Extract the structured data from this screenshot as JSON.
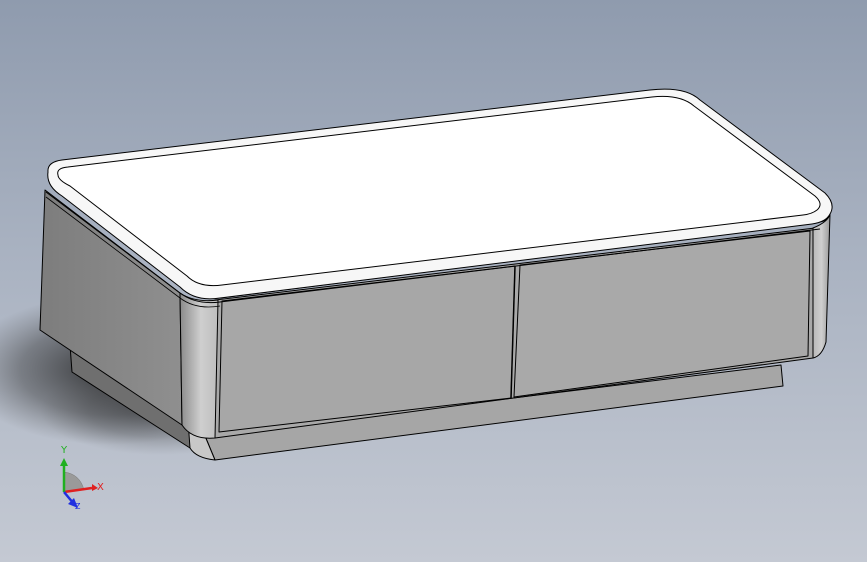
{
  "viewport": {
    "background_top": "#8f9bae",
    "background_bottom": "#c4c9d3"
  },
  "model": {
    "object": "coffee-table-with-two-drawers",
    "top_color": "#ffffff",
    "body_color": "#a9a9a9",
    "edge_color": "#000000"
  },
  "triad": {
    "x_label": "X",
    "y_label": "Y",
    "z_label": "Z",
    "x_color": "#e02020",
    "y_color": "#20b020",
    "z_color": "#2030e0"
  }
}
